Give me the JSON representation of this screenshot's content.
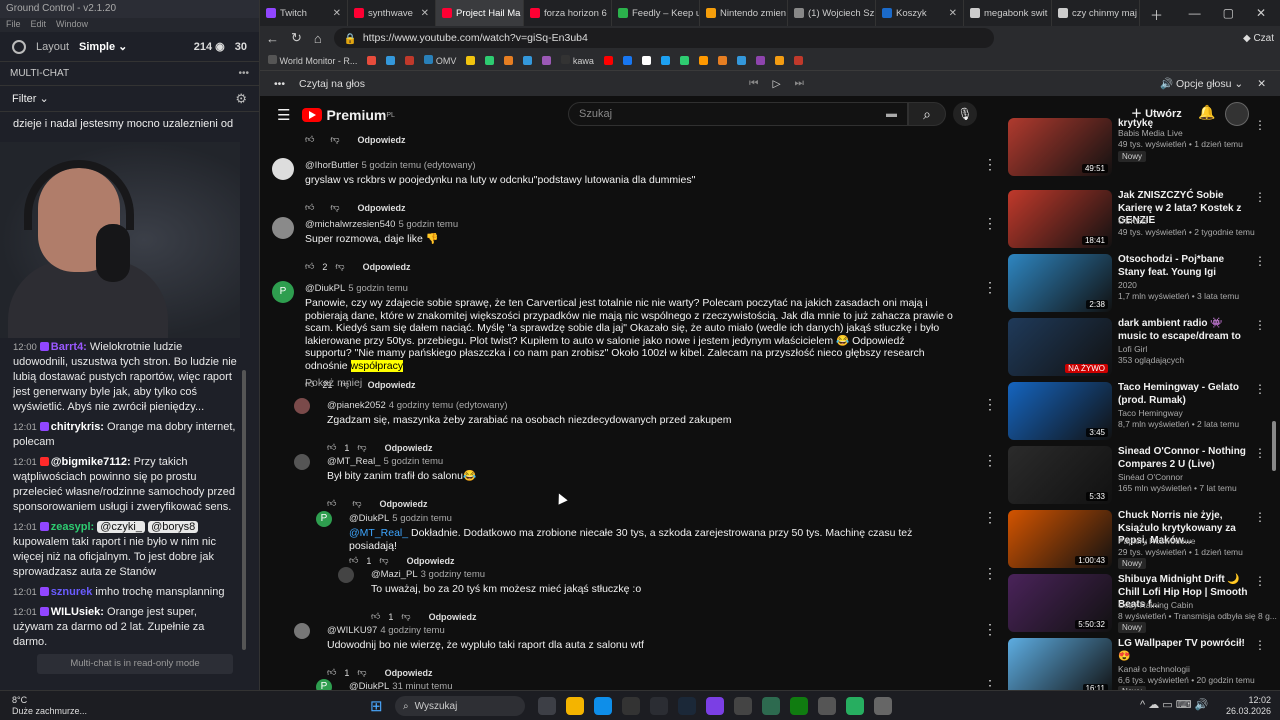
{
  "ground_control": {
    "title": "Ground Control - v2.1.20",
    "menu": [
      "File",
      "Edit",
      "Window"
    ],
    "layout_label": "Layout",
    "layout_value": "Simple",
    "viewers": "214",
    "count2": "30",
    "multichat_header": "MULTI-CHAT",
    "filter_label": "Filter",
    "top_message": "dzieje i nadal jestesmy mocno uzaleznieni od",
    "readonly_note": "Multi-chat is in read-only mode",
    "messages": [
      {
        "time": "12:00",
        "user": "Barrt4:",
        "text": " Wielokrotnie ludzie udowodnili, uszustwa tych stron. Bo ludzie nie lubią dostawać pustych raportów, więc raport jest generwany byle jak, aby tylko coś wyświetlić. Abyś nie zwrócił pieniędzy...",
        "ucolor": "#9b59ff",
        "badge": "#9146ff"
      },
      {
        "time": "12:01",
        "user": "chitrykris:",
        "text": " Orange ma dobry internet, polecam",
        "ucolor": "#ffffff",
        "badge": "#9146ff"
      },
      {
        "time": "12:01",
        "user": "@bigmike7112:",
        "text": " Przy takich wątpliwościach powinno się po prostu przelecieć własne/rodzinne samochody przed sponsorowaniem usługi i zweryfikować sens.",
        "ucolor": "#ffffff",
        "badge": "#ff2a2a"
      },
      {
        "time": "12:01",
        "user": "zeasypl:",
        "text": " kupowalem taki raport i nie było w nim nic więcej niż na oficjalnym. To jest dobre jak sprowadzasz auta ze Stanów",
        "ucolor": "#2ecc71",
        "badge": "#9146ff",
        "pills": [
          "@czyki_",
          "@borys8"
        ]
      },
      {
        "time": "12:01",
        "user": "sznurek",
        "text": " imho trochę mansplanning",
        "ucolor": "#6a5cff",
        "badge": "#9146ff"
      },
      {
        "time": "12:01",
        "user": "WILUsiek:",
        "text": " Orange jest super, używam za darmo od 2 lat. Zupełnie za darmo.",
        "ucolor": "#ffffff",
        "badge": "#9146ff"
      }
    ]
  },
  "browser": {
    "tabs": [
      {
        "label": "Twitch",
        "color": "#9146ff"
      },
      {
        "label": "synthwave",
        "color": "#ff0033"
      },
      {
        "label": "Project Hail Ma",
        "color": "#ff0033",
        "active": true
      },
      {
        "label": "forza horizon 6",
        "color": "#ff0033"
      },
      {
        "label": "Feedly – Keep u",
        "color": "#2bb24c"
      },
      {
        "label": "Nintendo zmien",
        "color": "#f59e0b"
      },
      {
        "label": "(1) Wojciech Sz",
        "color": "#888888"
      },
      {
        "label": "Koszyk",
        "color": "#1b6ac9"
      },
      {
        "label": "megabonk swit",
        "color": "#cccccc"
      },
      {
        "label": "czy chinmy maj",
        "color": "#cccccc"
      }
    ],
    "url": "https://www.youtube.com/watch?v=giSq-En3ub4",
    "bookmarks": [
      "World Monitor - R...",
      "OMV",
      "kawa"
    ],
    "read_aloud": "Czytaj na głos",
    "voice_options": "Opcje głosu",
    "chat_label": "Czat"
  },
  "youtube": {
    "logo_text": "Premium",
    "logo_sup": "PL",
    "search_placeholder": "Szukaj",
    "create_label": "Utwórz",
    "reply_label": "Odpowiedz",
    "comments": [
      {
        "name": "",
        "text": "",
        "likes": ""
      },
      {
        "name": "@IhorButtler",
        "time": "5 godzin temu (edytowany)",
        "text": "gryslaw vs rckbrs w poojedynku na luty w odcnku\"podstawy lutowania dla dummies\"",
        "likes": ""
      },
      {
        "name": "@michalwrzesien540",
        "time": "5 godzin temu",
        "text": "Super rozmowa, daje like 👎",
        "likes": "2"
      },
      {
        "name": "@DiukPL",
        "time": "5 godzin temu",
        "text": "Panowie, czy wy zdajecie sobie sprawę, że ten Carvertical jest totalnie nic nie warty? Polecam poczytać na jakich zasadach oni mają i pobierają dane, które w znakomitej większości przypadków nie mają nic wspólnego z rzeczywistością. Jak dla mnie to już zahacza prawie o scam. Kiedyś sam się dałem naciąć. Myślę \"a sprawdzę sobie dla jaj\" Okazało się, że auto miało (wedle ich danych) jakąś stłuczkę i było lakierowane przy 50tys. przebiegu. Plot twist? Kupiłem to auto w salonie jako nowe i jestem jedynym właścicielem 😂 Odpowiedź supportu? \"Nie mamy pańskiego płaszczka i co nam pan zrobisz\" Około 100zł w kibel. Zalecam na przyszłość nieco głębszy research odnośnie",
        "highlight": "współpracy",
        "show_less": "Pokaż mniej",
        "likes": "21"
      },
      {
        "name": "@pianek2052",
        "time": "4 godziny temu (edytowany)",
        "text": "Zgadzam się, maszynka żeby zarabiać na osobach niezdecydowanych przed zakupem",
        "likes": "1"
      },
      {
        "name": "@MT_Real_",
        "time": "5 godzin temu",
        "text": "Był bity zanim trafił do salonu😂",
        "likes": ""
      },
      {
        "name": "@DiukPL",
        "time": "5 godzin temu",
        "mention": "@MT_Real_",
        "text": " Dokładnie. Dodatkowo ma zrobione niecałe 30 tys,  a szkoda zarejestrowana przy 50 tys. Machinę czasu też posiadają!",
        "likes": "1"
      },
      {
        "name": "@Mazi_PL",
        "time": "3 godziny temu",
        "text": "To uważaj, bo za 20 tyś km możesz mieć jakąś stłuczkę :o",
        "likes": "1"
      },
      {
        "name": "@WILKU97",
        "time": "4 godziny temu",
        "text": "Udowodnij bo nie wierzę, że wypluło taki raport dla auta z salonu wtf",
        "likes": "1"
      },
      {
        "name": "@DiukPL",
        "time": "31 minut temu",
        "text": "",
        "likes": ""
      }
    ],
    "sidebar": [
      {
        "title": "krytykę",
        "channel": "Babis Media Live",
        "meta": "49 tys. wyświetleń • 1 dzień temu",
        "badge": "Nowy",
        "duration": "49:51",
        "bg": "#b03a2e"
      },
      {
        "title": "Jak ZNISZCZYĆ Sobie Karierę w 2 lata?  Kostek z GENZIE",
        "channel": "OSKEE",
        "meta": "49 tys. wyświetleń • 2 tygodnie temu",
        "badge": "",
        "duration": "18:41",
        "bg": "#c0392b"
      },
      {
        "title": "Otsochodzi - Poj*bane Stany feat. Young Igi",
        "channel": "2020",
        "meta": "1,7 mln wyświetleń • 3 lata temu",
        "badge": "",
        "duration": "2:38",
        "bg": "#2e86c1"
      },
      {
        "title": "dark ambient radio 👾 music to escape/dream to",
        "channel": "Lofi Girl",
        "meta": "353 oglądających",
        "badge": "",
        "duration": "NA ŻYWO",
        "bg": "#1f3a5a"
      },
      {
        "title": "Taco Hemingway - Gelato (prod. Rumak)",
        "channel": "Taco Hemingway",
        "meta": "8,7 mln wyświetleń • 2 lata temu",
        "badge": "",
        "duration": "3:45",
        "bg": "#1565c0"
      },
      {
        "title": "Sinead O'Connor - Nothing Compares 2 U (Live)",
        "channel": "Sinéad O'Connor",
        "meta": "165 mln wyświetleń • 7 lat temu",
        "badge": "",
        "duration": "5:33",
        "bg": "#2b2b2b"
      },
      {
        "title": "Chuck Norris nie żyje, Książulo krytykowany za Pepsi, Maków...",
        "channel": "Papiery Rozwodowe",
        "meta": "29 tys. wyświetleń • 1 dzień temu",
        "badge": "Nowy",
        "duration": "1:00:43",
        "bg": "#d35400"
      },
      {
        "title": "Shibuya Midnight Drift 🌙 Chill Lofi Hip Hop | Smooth Beats f...",
        "channel": "Cozy Raining Cabin",
        "meta": "8 wyświetleń • Transmisja odbyła się 8 g...",
        "badge": "Nowy",
        "duration": "5:50:32",
        "bg": "#4a235a"
      },
      {
        "title": "LG Wallpaper TV powrócił! 😍",
        "channel": "Kanał o technologii",
        "meta": "6,6 tys. wyświetleń • 20 godzin temu",
        "badge": "Nowy",
        "duration": "16:11",
        "bg": "#5dade2"
      }
    ]
  },
  "taskbar": {
    "temp": "8°C",
    "weather": "Duże zachmurze...",
    "search": "Wyszukaj",
    "time": "12:02",
    "date": "26.03.2026"
  }
}
